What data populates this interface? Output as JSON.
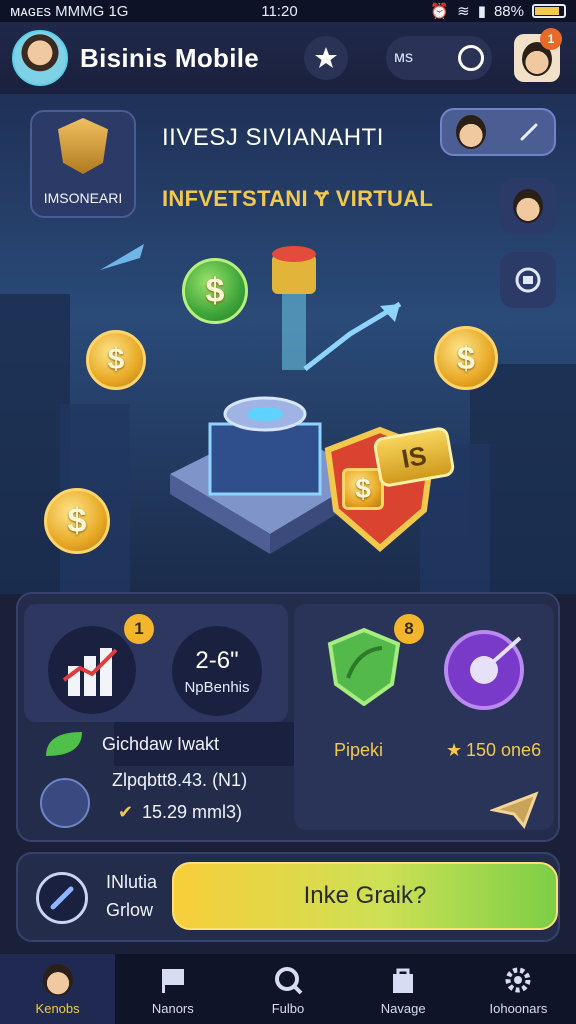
{
  "status": {
    "left": "ᴍᴀɢᴇs MMMG 1G",
    "time": "11:20",
    "battery": "88%"
  },
  "header": {
    "title": "Bisinis Mobile",
    "toggle_label": "ᴍs",
    "notification_count": "1"
  },
  "hero": {
    "profile_label": "IMSONEARI",
    "title": "IIVESJ SIVIANAHTI",
    "subtitle": "INFVETSTANI Ɏ VIRTUAL",
    "coin_symbol": "$",
    "shield_coin": "$",
    "shield_tag": "IS"
  },
  "stats": {
    "chart_badge": "1",
    "stat_value": "2-6\"",
    "stat_label": "NpBenhis",
    "leaf_badge": "8",
    "left_row_label": "Gichdaw Iwakt",
    "right_row_label": "Pipeki",
    "star_value": "150 one6",
    "detail_line1": "Zlpqbtt8.43. (N1)",
    "detail_line2": "15.29 mml3)"
  },
  "cta": {
    "text_line1": "INlutia",
    "text_line2": "Grlow",
    "button_label": "Inke Graik?"
  },
  "nav": {
    "items": [
      {
        "label": "Kenobs"
      },
      {
        "label": "Nanors"
      },
      {
        "label": "Fulbo"
      },
      {
        "label": "Navage"
      },
      {
        "label": "Iohoonars"
      }
    ]
  },
  "colors": {
    "accent": "#f2c94c",
    "panel": "#242c4c",
    "background": "#1a2038"
  }
}
